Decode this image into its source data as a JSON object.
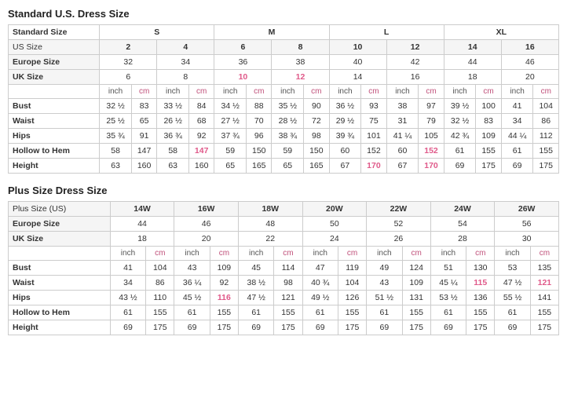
{
  "standard_title": "Standard U.S. Dress Size",
  "plus_title": "Plus Size Dress Size",
  "standard": {
    "size_groups": [
      "S",
      "M",
      "L",
      "XL"
    ],
    "us_sizes": [
      "2",
      "4",
      "6",
      "8",
      "10",
      "12",
      "14",
      "16"
    ],
    "europe_sizes": [
      "32",
      "34",
      "36",
      "38",
      "40",
      "42",
      "44",
      "46"
    ],
    "uk_sizes": [
      "6",
      "8",
      "10",
      "12",
      "14",
      "16",
      "18",
      "20"
    ],
    "uk_highlights": [
      2,
      3
    ],
    "bust": [
      {
        "inch": "32 ½",
        "cm": "83"
      },
      {
        "inch": "33 ½",
        "cm": "84"
      },
      {
        "inch": "34 ½",
        "cm": "88"
      },
      {
        "inch": "35 ½",
        "cm": "90"
      },
      {
        "inch": "36 ½",
        "cm": "93"
      },
      {
        "inch": "38",
        "cm": "97"
      },
      {
        "inch": "39 ½",
        "cm": "100"
      },
      {
        "inch": "41",
        "cm": "104"
      }
    ],
    "waist": [
      {
        "inch": "25 ½",
        "cm": "65"
      },
      {
        "inch": "26 ½",
        "cm": "68"
      },
      {
        "inch": "27 ½",
        "cm": "70"
      },
      {
        "inch": "28 ½",
        "cm": "72"
      },
      {
        "inch": "29 ½",
        "cm": "75"
      },
      {
        "inch": "31",
        "cm": "79"
      },
      {
        "inch": "32 ½",
        "cm": "83"
      },
      {
        "inch": "34",
        "cm": "86"
      }
    ],
    "hips": [
      {
        "inch": "35 ¾",
        "cm": "91"
      },
      {
        "inch": "36 ¾",
        "cm": "92"
      },
      {
        "inch": "37 ¾",
        "cm": "96"
      },
      {
        "inch": "38 ¾",
        "cm": "98"
      },
      {
        "inch": "39 ¾",
        "cm": "101"
      },
      {
        "inch": "41 ¼",
        "cm": "105"
      },
      {
        "inch": "42 ¾",
        "cm": "109"
      },
      {
        "inch": "44 ¼",
        "cm": "112"
      }
    ],
    "hollow_to_hem": [
      {
        "inch": "58",
        "cm": "147"
      },
      {
        "inch": "58",
        "cm": "147"
      },
      {
        "inch": "59",
        "cm": "150"
      },
      {
        "inch": "59",
        "cm": "150"
      },
      {
        "inch": "60",
        "cm": "152"
      },
      {
        "inch": "60",
        "cm": "152"
      },
      {
        "inch": "61",
        "cm": "155"
      },
      {
        "inch": "61",
        "cm": "155"
      }
    ],
    "hollow_highlights_cm": [
      1,
      5
    ],
    "height": [
      {
        "inch": "63",
        "cm": "160"
      },
      {
        "inch": "63",
        "cm": "160"
      },
      {
        "inch": "65",
        "cm": "165"
      },
      {
        "inch": "65",
        "cm": "165"
      },
      {
        "inch": "67",
        "cm": "170"
      },
      {
        "inch": "67",
        "cm": "170"
      },
      {
        "inch": "69",
        "cm": "175"
      },
      {
        "inch": "69",
        "cm": "175"
      }
    ]
  },
  "plus": {
    "us_sizes": [
      "14W",
      "16W",
      "18W",
      "20W",
      "22W",
      "24W",
      "26W"
    ],
    "europe_sizes": [
      "44",
      "46",
      "48",
      "50",
      "52",
      "54",
      "56"
    ],
    "uk_sizes": [
      "18",
      "20",
      "22",
      "24",
      "26",
      "28",
      "30"
    ],
    "bust": [
      {
        "inch": "41",
        "cm": "104"
      },
      {
        "inch": "43",
        "cm": "109"
      },
      {
        "inch": "45",
        "cm": "114"
      },
      {
        "inch": "47",
        "cm": "119"
      },
      {
        "inch": "49",
        "cm": "124"
      },
      {
        "inch": "51",
        "cm": "130"
      },
      {
        "inch": "53",
        "cm": "135"
      }
    ],
    "waist": [
      {
        "inch": "34",
        "cm": "86"
      },
      {
        "inch": "36 ¼",
        "cm": "92"
      },
      {
        "inch": "38 ½",
        "cm": "98"
      },
      {
        "inch": "40 ¾",
        "cm": "104"
      },
      {
        "inch": "43",
        "cm": "109"
      },
      {
        "inch": "45 ¼",
        "cm": "115"
      },
      {
        "inch": "47 ½",
        "cm": "121"
      }
    ],
    "waist_highlights_cm": [
      5,
      6
    ],
    "hips": [
      {
        "inch": "43 ½",
        "cm": "110"
      },
      {
        "inch": "45 ½",
        "cm": "116"
      },
      {
        "inch": "47 ½",
        "cm": "121"
      },
      {
        "inch": "49 ½",
        "cm": "126"
      },
      {
        "inch": "51 ½",
        "cm": "131"
      },
      {
        "inch": "53 ½",
        "cm": "136"
      },
      {
        "inch": "55 ½",
        "cm": "141"
      }
    ],
    "hips_highlights_cm": [
      1
    ],
    "hollow_to_hem": [
      {
        "inch": "61",
        "cm": "155"
      },
      {
        "inch": "61",
        "cm": "155"
      },
      {
        "inch": "61",
        "cm": "155"
      },
      {
        "inch": "61",
        "cm": "155"
      },
      {
        "inch": "61",
        "cm": "155"
      },
      {
        "inch": "61",
        "cm": "155"
      },
      {
        "inch": "61",
        "cm": "155"
      }
    ],
    "height": [
      {
        "inch": "69",
        "cm": "175"
      },
      {
        "inch": "69",
        "cm": "175"
      },
      {
        "inch": "69",
        "cm": "175"
      },
      {
        "inch": "69",
        "cm": "175"
      },
      {
        "inch": "69",
        "cm": "175"
      },
      {
        "inch": "69",
        "cm": "175"
      },
      {
        "inch": "69",
        "cm": "175"
      }
    ]
  },
  "labels": {
    "standard_size": "Standard Size",
    "us_size": "US Size",
    "europe_size": "Europe Size",
    "uk_size": "UK Size",
    "bust": "Bust",
    "waist": "Waist",
    "hips": "Hips",
    "hollow_to_hem": "Hollow to Hem",
    "height": "Height",
    "inch": "inch",
    "cm": "cm",
    "plus_size_us": "Plus Size (US)",
    "s": "S",
    "m": "M",
    "l": "L",
    "xl": "XL"
  }
}
